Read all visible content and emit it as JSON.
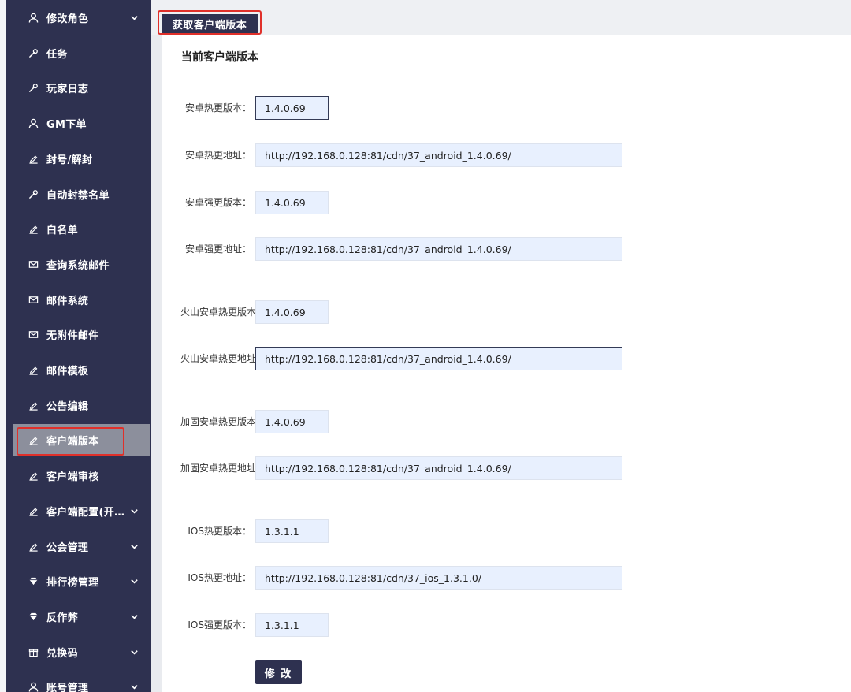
{
  "sidebar": {
    "items": [
      {
        "label": "修改角色",
        "icon": "user-icon",
        "chevron": true
      },
      {
        "label": "任务",
        "icon": "wrench-icon",
        "chevron": false
      },
      {
        "label": "玩家日志",
        "icon": "wrench-icon",
        "chevron": false
      },
      {
        "label": "GM下单",
        "icon": "user-icon",
        "chevron": false
      },
      {
        "label": "封号/解封",
        "icon": "edit-icon",
        "chevron": false
      },
      {
        "label": "自动封禁名单",
        "icon": "wrench-icon",
        "chevron": false
      },
      {
        "label": "白名单",
        "icon": "edit-icon",
        "chevron": false
      },
      {
        "label": "查询系统邮件",
        "icon": "mail-icon",
        "chevron": false
      },
      {
        "label": "邮件系统",
        "icon": "mail-icon",
        "chevron": false
      },
      {
        "label": "无附件邮件",
        "icon": "mail-icon",
        "chevron": false
      },
      {
        "label": "邮件模板",
        "icon": "edit-icon",
        "chevron": false
      },
      {
        "label": "公告编辑",
        "icon": "edit-icon",
        "chevron": false
      },
      {
        "label": "客户端版本",
        "icon": "edit-icon",
        "chevron": false,
        "active": true
      },
      {
        "label": "客户端审核",
        "icon": "edit-icon",
        "chevron": false
      },
      {
        "label": "客户端配置(开…",
        "icon": "edit-icon",
        "chevron": true
      },
      {
        "label": "公会管理",
        "icon": "edit-icon",
        "chevron": true
      },
      {
        "label": "排行榜管理",
        "icon": "diamond-icon",
        "chevron": true
      },
      {
        "label": "反作弊",
        "icon": "diamond-icon",
        "chevron": true
      },
      {
        "label": "兑换码",
        "icon": "gift-icon",
        "chevron": true
      },
      {
        "label": "账号管理",
        "icon": "user-icon",
        "chevron": true
      }
    ]
  },
  "toolbar": {
    "fetch_button": "获取客户端版本"
  },
  "panel": {
    "title": "当前客户端版本",
    "submit_label": "修 改"
  },
  "form": {
    "rows": [
      {
        "label": "安卓热更版本：",
        "value": "1.4.0.69"
      },
      {
        "label": "安卓热更地址：",
        "value": "http://192.168.0.128:81/cdn/37_android_1.4.0.69/"
      },
      {
        "label": "安卓强更版本：",
        "value": "1.4.0.69"
      },
      {
        "label": "安卓强更地址：",
        "value": "http://192.168.0.128:81/cdn/37_android_1.4.0.69/"
      },
      {
        "label": "火山安卓热更版本：",
        "value": "1.4.0.69"
      },
      {
        "label": "火山安卓热更地址：",
        "value": "http://192.168.0.128:81/cdn/37_android_1.4.0.69/"
      },
      {
        "label": "加固安卓热更版本：",
        "value": "1.4.0.69"
      },
      {
        "label": "加固安卓热更地址：",
        "value": "http://192.168.0.128:81/cdn/37_android_1.4.0.69/"
      },
      {
        "label": "IOS热更版本：",
        "value": "1.3.1.1"
      },
      {
        "label": "IOS热更地址：",
        "value": "http://192.168.0.128:81/cdn/37_ios_1.3.1.0/"
      },
      {
        "label": "IOS强更版本：",
        "value": "1.3.1.1"
      }
    ]
  }
}
